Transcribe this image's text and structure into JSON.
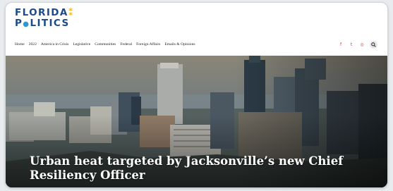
{
  "brand": {
    "logo_line1_main": "FLORIDA",
    "logo_line1_accent": "⁑",
    "logo_line2_p": "P",
    "logo_line2_dot": "●",
    "logo_line2_rest": "LITICS",
    "primary_color": "#1b4a8b",
    "accent_yellow": "#f4b41a",
    "accent_blue": "#2a9ad6"
  },
  "nav": {
    "items": [
      "Home",
      "2022",
      "America in Crisis",
      "Legislative",
      "Communities",
      "Federal",
      "Foreign Affairs",
      "Emails & Opinions"
    ]
  },
  "social": {
    "icons": [
      "facebook-icon",
      "twitter-icon",
      "instagram-icon",
      "search-icon"
    ],
    "glyphs": [
      "f",
      "t",
      "◎",
      "🔍"
    ],
    "color": "#e2352a"
  },
  "hero": {
    "headline": "Urban heat targeted by Jacksonville’s new Chief Resiliency Officer",
    "image_description_icon": "city-skyline-photo"
  }
}
